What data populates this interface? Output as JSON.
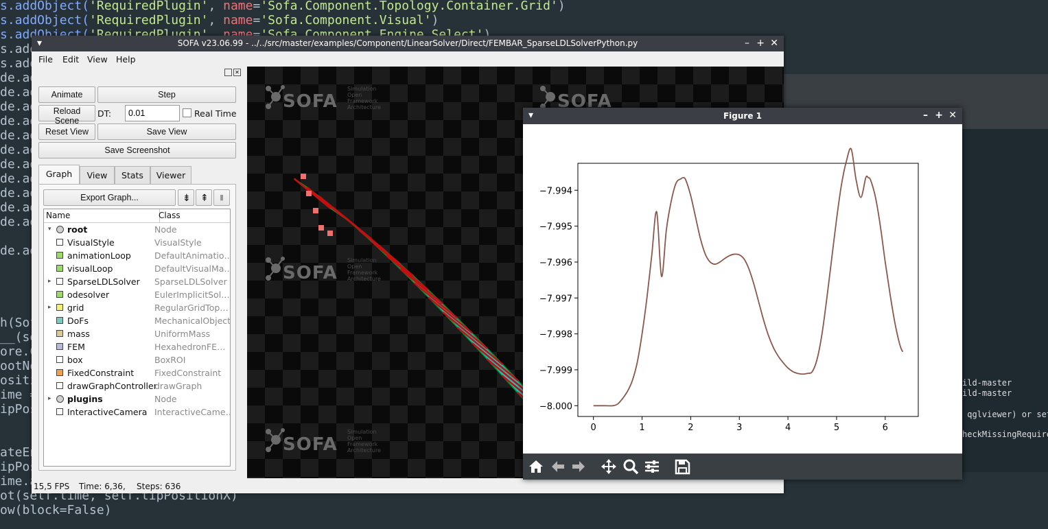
{
  "editor": {
    "lines": [
      {
        "y": -2,
        "pre": "s.addObject(",
        "str": "'RequiredPlugin'",
        "mid": ", ",
        "kw": "name",
        "eq": "=",
        "val": "'Sofa.Component.Topology.Container.Grid'",
        "end": ")"
      },
      {
        "y": 19,
        "pre": "s.addObject(",
        "str": "'RequiredPlugin'",
        "mid": ", ",
        "kw": "name",
        "eq": "=",
        "val": "'Sofa.Component.Visual'",
        "end": ")"
      },
      {
        "y": 40,
        "pre": "s.addObject(",
        "str": "'RequiredPlugin'",
        "mid": ", ",
        "kw": "name",
        "eq": "=",
        "val": "'Sofa.Component.Engine.Select'",
        "end": ")"
      }
    ],
    "left_fragments": [
      {
        "y": 61,
        "text": "s.add"
      },
      {
        "y": 82,
        "text": "s.add"
      },
      {
        "y": 103,
        "text": "de.ad"
      },
      {
        "y": 124,
        "text": "de.ad"
      },
      {
        "y": 145,
        "text": "de.ad"
      },
      {
        "y": 166,
        "text": "de.ad"
      },
      {
        "y": 187,
        "text": "de.ad"
      },
      {
        "y": 208,
        "text": "de.ad"
      },
      {
        "y": 229,
        "text": "de.ad"
      },
      {
        "y": 250,
        "text": "de.ad"
      },
      {
        "y": 271,
        "text": "de.ad"
      },
      {
        "y": 292,
        "text": "de.ad"
      },
      {
        "y": 313,
        "text": "de.ad"
      },
      {
        "y": 355,
        "text": "de.ad"
      },
      {
        "y": 460,
        "text": "h(Sof"
      },
      {
        "y": 481,
        "text": "__(se"
      },
      {
        "y": 502,
        "text": "ore.C"
      },
      {
        "y": 523,
        "text": "ootNo"
      },
      {
        "y": 544,
        "text": "ositi"
      },
      {
        "y": 565,
        "text": "ime ="
      },
      {
        "y": 586,
        "text": "ipPos"
      },
      {
        "y": 649,
        "text": "ateEn"
      },
      {
        "y": 670,
        "text": "ipPos"
      },
      {
        "y": 691,
        "text": "ime.a"
      }
    ],
    "bottom_lines": [
      {
        "y": 712,
        "text": "ot(self.time, self.tipPositionX)"
      },
      {
        "y": 733,
        "text": "ow(block=False)"
      }
    ]
  },
  "console": {
    "lines": [
      {
        "y": 443,
        "text": "ild-master"
      },
      {
        "y": 458,
        "text": "ild-master"
      },
      {
        "y": 489,
        "text": " qglviewer) or set"
      },
      {
        "y": 518,
        "text": "heckMissingRequire"
      }
    ]
  },
  "sofa": {
    "title": "SOFA v23.06.99 - ../../src/master/examples/Component/LinearSolver/Direct/FEMBAR_SparseLDLSolverPython.py",
    "menu": [
      "File",
      "Edit",
      "View",
      "Help"
    ],
    "animate_label": "Animate",
    "step_label": "Step",
    "reload_label": "Reload Scene",
    "dt_label": "DT:",
    "dt_value": "0.01",
    "realtime_label": "Real Time",
    "reset_view_label": "Reset View",
    "save_view_label": "Save View",
    "save_screenshot_label": "Save Screenshot",
    "tabs": [
      "Graph",
      "View",
      "Stats",
      "Viewer"
    ],
    "export_graph_label": "Export Graph...",
    "tree_headers": {
      "name": "Name",
      "class": "Class"
    },
    "tree_rows": [
      {
        "name": "root",
        "class": "Node",
        "bold": true,
        "arrow": "▾",
        "icon": "node",
        "color": "#d0d0d0",
        "indent": 0
      },
      {
        "name": "VisualStyle",
        "class": "VisualStyle",
        "icon": "box",
        "color": "#ffffff",
        "indent": 1
      },
      {
        "name": "animationLoop",
        "class": "DefaultAnimatio…",
        "icon": "box",
        "color": "#9dd86a",
        "indent": 1
      },
      {
        "name": "visualLoop",
        "class": "DefaultVisualMa…",
        "icon": "box",
        "color": "#9dd86a",
        "indent": 1
      },
      {
        "name": "SparseLDLSolver",
        "class": "SparseLDLSolver",
        "arrow": "▸",
        "icon": "box",
        "color": "#ffffff",
        "indent": 1
      },
      {
        "name": "odesolver",
        "class": "EulerImplicitSol…",
        "icon": "box",
        "color": "#9dd86a",
        "indent": 1
      },
      {
        "name": "grid",
        "class": "RegularGridTop…",
        "arrow": "▸",
        "icon": "box",
        "color": "#f4f07a",
        "indent": 1
      },
      {
        "name": "DoFs",
        "class": "MechanicalObject",
        "icon": "box",
        "color": "#7ec8c0",
        "indent": 1
      },
      {
        "name": "mass",
        "class": "UniformMass",
        "icon": "box",
        "color": "#d8c89a",
        "indent": 1
      },
      {
        "name": "FEM",
        "class": "HexahedronFE…",
        "icon": "box",
        "color": "#b8b8dc",
        "indent": 1
      },
      {
        "name": "box",
        "class": "BoxROI",
        "icon": "box",
        "color": "#ffffff",
        "indent": 1
      },
      {
        "name": "FixedConstraint",
        "class": "FixedConstraint",
        "icon": "box",
        "color": "#f0a050",
        "indent": 1
      },
      {
        "name": "drawGraphController",
        "class": "drawGraph",
        "icon": "box",
        "color": "#ffffff",
        "indent": 1
      },
      {
        "name": "plugins",
        "class": "Node",
        "bold": true,
        "arrow": "▸",
        "icon": "node",
        "color": "#d0d0d0",
        "indent": 1
      },
      {
        "name": "InteractiveCamera",
        "class": "InteractiveCame…",
        "icon": "box",
        "color": "#ffffff",
        "indent": 1
      }
    ],
    "status": {
      "fps": "15,5 FPS",
      "time": "Time: 6,36,",
      "steps": "Steps:  636"
    },
    "logo_word": "SOFA",
    "logo_sub": [
      "Simulation",
      "Open",
      "Framework",
      "Architecture"
    ]
  },
  "figure": {
    "title": "Figure 1",
    "toolbar": [
      "home-icon",
      "back-icon",
      "forward-icon",
      "pan-icon",
      "zoom-icon",
      "configure-icon",
      "save-icon"
    ]
  },
  "chart_data": {
    "type": "line",
    "title": "",
    "xlabel": "",
    "ylabel": "",
    "xlim": [
      -0.32,
      6.68
    ],
    "ylim": [
      -8.0003,
      -7.99325
    ],
    "xticks": [
      0,
      1,
      2,
      3,
      4,
      5,
      6
    ],
    "yticks": [
      -8.0,
      -7.999,
      -7.998,
      -7.997,
      -7.996,
      -7.995,
      -7.994
    ],
    "ytick_labels": [
      "−8.000",
      "−7.999",
      "−7.998",
      "−7.997",
      "−7.996",
      "−7.995",
      "−7.994"
    ],
    "color": "#8c564b",
    "series": [
      {
        "x": [
          0,
          0.2,
          0.4,
          0.5,
          0.6,
          0.7,
          0.8,
          0.9,
          1.0,
          1.1,
          1.2,
          1.3,
          1.4,
          1.5,
          1.6,
          1.7,
          1.8,
          1.85,
          1.9,
          2.0,
          2.1,
          2.2,
          2.3,
          2.4,
          2.5,
          2.6,
          2.7,
          2.8,
          2.9,
          3.0,
          3.1,
          3.2,
          3.3,
          3.4,
          3.5,
          3.6,
          3.7,
          3.8,
          3.9,
          4.0,
          4.1,
          4.2,
          4.3,
          4.4,
          4.5,
          4.6,
          4.7,
          4.8,
          4.9,
          5.0,
          5.1,
          5.2,
          5.3,
          5.4,
          5.5,
          5.6,
          5.65,
          5.7,
          5.8,
          5.9,
          6.0,
          6.1,
          6.2,
          6.3,
          6.36
        ],
        "y": [
          -8.0,
          -8.0,
          -8.0,
          -7.99995,
          -7.9998,
          -7.9996,
          -7.9993,
          -7.9988,
          -7.998,
          -7.997,
          -7.9958,
          -7.9946,
          -7.9964,
          -7.9951,
          -7.9943,
          -7.9938,
          -7.99368,
          -7.99365,
          -7.99372,
          -7.99415,
          -7.99475,
          -7.99535,
          -7.99578,
          -7.996,
          -7.99606,
          -7.996,
          -7.9959,
          -7.99582,
          -7.99578,
          -7.9958,
          -7.99592,
          -7.9962,
          -7.99662,
          -7.99712,
          -7.99762,
          -7.99805,
          -7.99838,
          -7.99862,
          -7.9988,
          -7.99895,
          -7.99905,
          -7.9991,
          -7.99912,
          -7.9991,
          -7.99905,
          -7.9987,
          -7.998,
          -7.997,
          -7.9959,
          -7.9948,
          -7.99385,
          -7.9932,
          -7.99285,
          -7.9937,
          -7.9942,
          -7.99365,
          -7.99365,
          -7.99372,
          -7.9942,
          -7.995,
          -7.996,
          -7.9969,
          -7.9977,
          -7.9983,
          -7.9985
        ]
      }
    ]
  }
}
